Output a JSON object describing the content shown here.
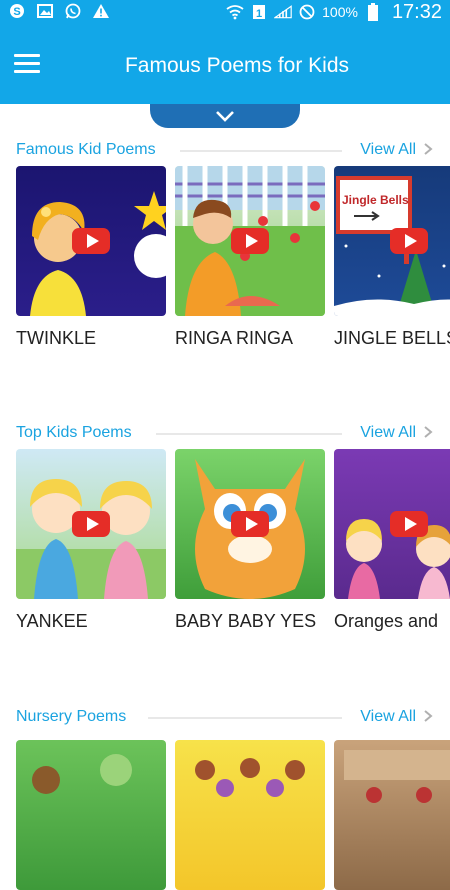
{
  "status_bar": {
    "battery_text": "100%",
    "time": "17:32",
    "left_icons": [
      "skype-icon",
      "image-icon",
      "whatsapp-icon",
      "warning-icon"
    ],
    "right_icons": [
      "wifi-icon",
      "sim-icon",
      "signal-icon",
      "no-sound-icon",
      "battery-icon"
    ]
  },
  "app_bar": {
    "title": "Famous Poems for Kids",
    "menu_icon": "hamburger-menu-icon"
  },
  "pull_tab": {
    "icon": "chevron-down-icon"
  },
  "sections": [
    {
      "title": "Famous Kid Poems",
      "view_all": "View All",
      "items": [
        {
          "label": "TWINKLE"
        },
        {
          "label": "RINGA RINGA"
        },
        {
          "label": "JINGLE BELLS",
          "thumb_text": "Jingle Bells"
        }
      ]
    },
    {
      "title": "Top Kids Poems",
      "view_all": "View All",
      "items": [
        {
          "label": "YANKEE"
        },
        {
          "label": "BABY BABY YES"
        },
        {
          "label": "Oranges and"
        }
      ]
    },
    {
      "title": "Nursery Poems",
      "view_all": "View All",
      "items": [
        {
          "label": ""
        },
        {
          "label": ""
        },
        {
          "label": ""
        }
      ]
    }
  ],
  "colors": {
    "primary": "#12a7e8",
    "accent_text": "#1aa3e0",
    "pull_tab": "#1f6fb5",
    "play_button": "#e52d27"
  }
}
